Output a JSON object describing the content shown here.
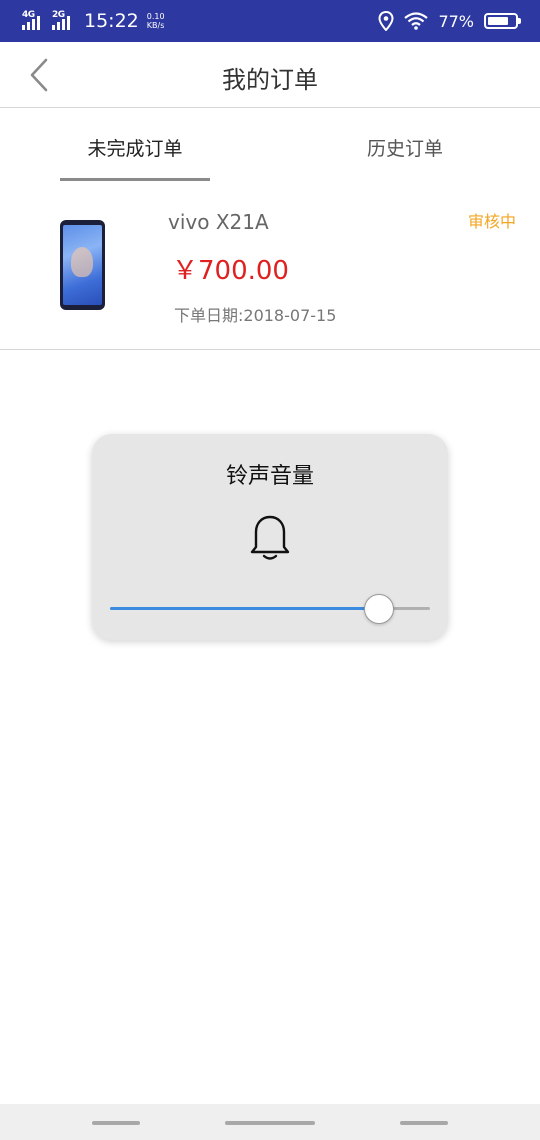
{
  "status_bar": {
    "network_1": "4G",
    "network_2": "2G",
    "time": "15:22",
    "speed_value": "0.10",
    "speed_unit": "KB/s",
    "battery_percent": "77%",
    "battery_level": 0.77
  },
  "header": {
    "title": "我的订单"
  },
  "tabs": [
    {
      "label": "未完成订单",
      "active": true
    },
    {
      "label": "历史订单",
      "active": false
    }
  ],
  "order": {
    "product_name": "vivo X21A",
    "price": "￥700.00",
    "date": "下单日期:2018-07-15",
    "status": "审核中"
  },
  "volume_popup": {
    "title": "铃声音量",
    "icon": "bell-icon",
    "level": 0.84
  },
  "colors": {
    "status_bar": "#2d39a0",
    "price": "#e02020",
    "status": "#f5a623",
    "slider_fill": "#3c8be0"
  }
}
